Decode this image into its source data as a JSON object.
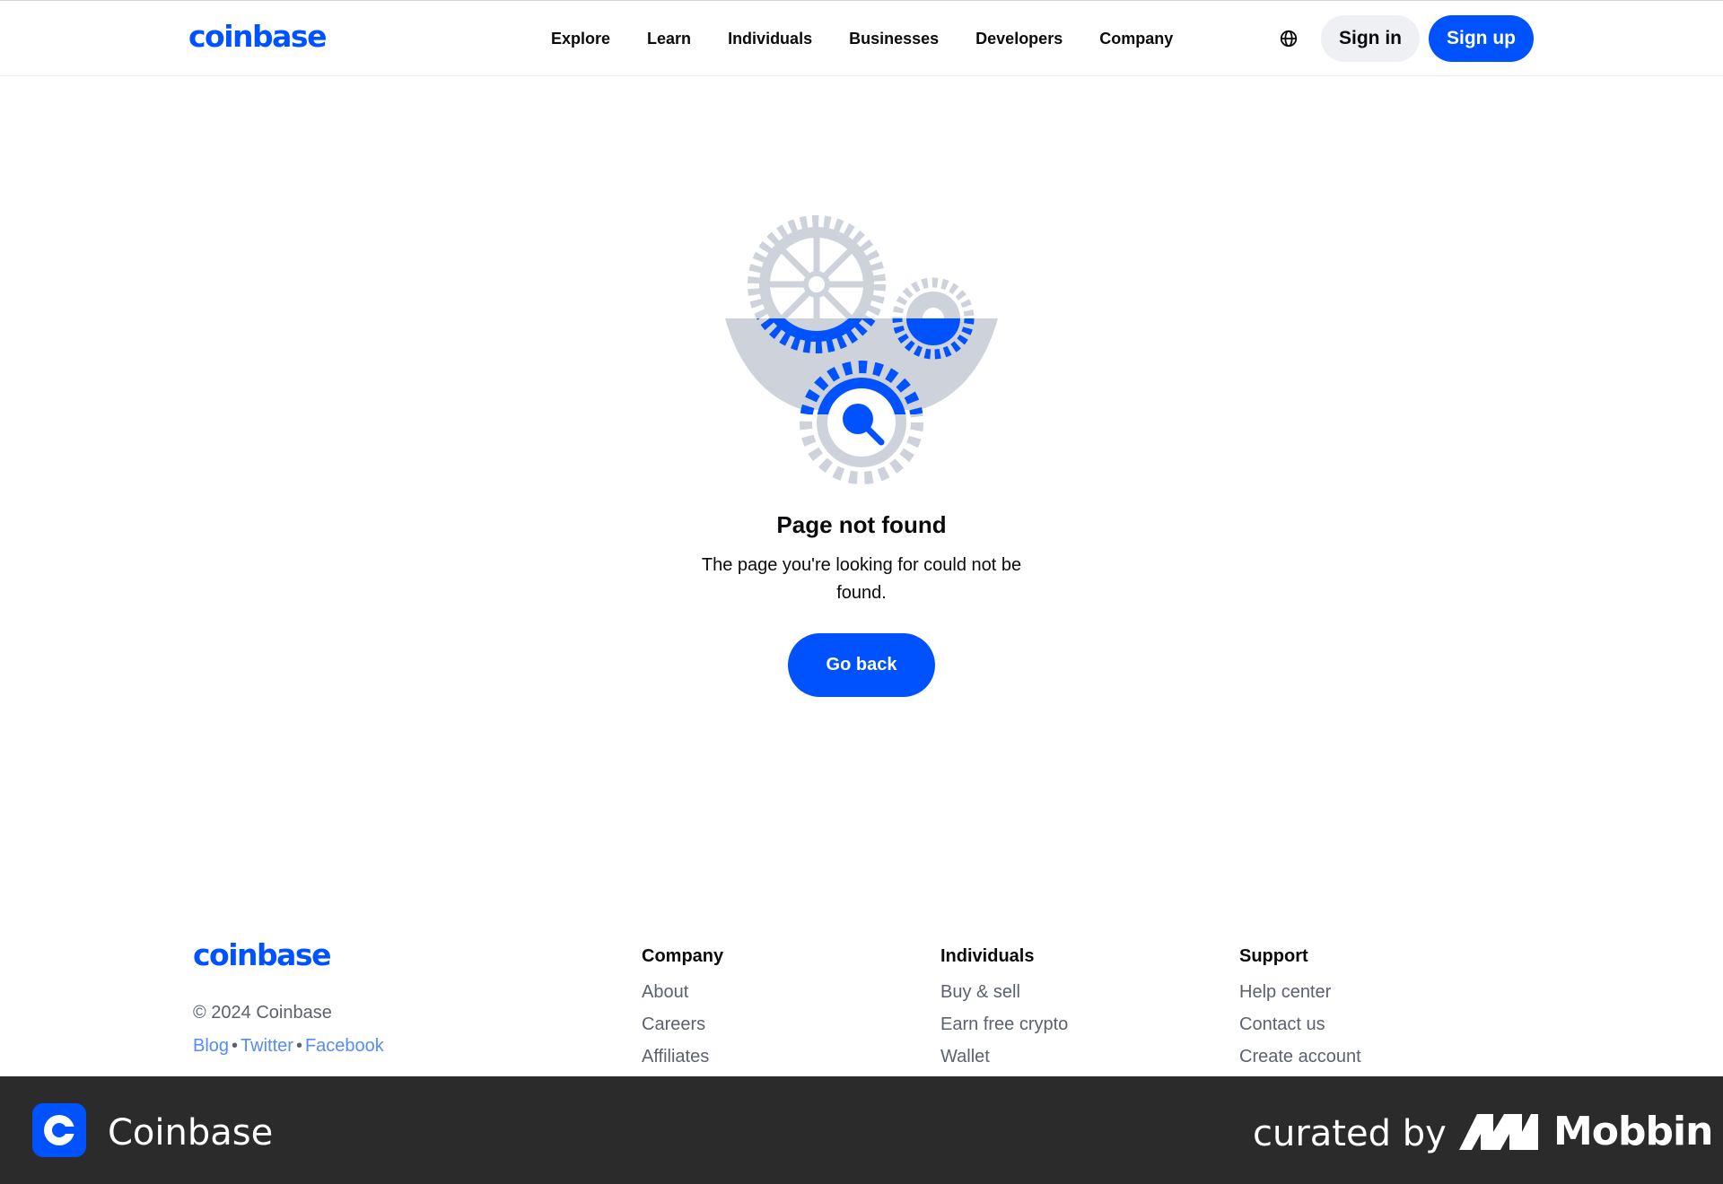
{
  "header": {
    "logo": "coinbase",
    "nav": [
      "Explore",
      "Learn",
      "Individuals",
      "Businesses",
      "Developers",
      "Company"
    ],
    "globe_icon": "globe-icon",
    "sign_in": "Sign in",
    "sign_up": "Sign up"
  },
  "main": {
    "illustration_icon": "gears-search-icon",
    "title": "Page not found",
    "description": "The page you're looking for could not be found.",
    "go_back": "Go back"
  },
  "footer": {
    "logo": "coinbase",
    "copyright": "© 2024 Coinbase",
    "social": [
      "Blog",
      "Twitter",
      "Facebook"
    ],
    "columns": [
      {
        "heading": "Company",
        "links": [
          "About",
          "Careers",
          "Affiliates"
        ]
      },
      {
        "heading": "Individuals",
        "links": [
          "Buy & sell",
          "Earn free crypto",
          "Wallet"
        ]
      },
      {
        "heading": "Support",
        "links": [
          "Help center",
          "Contact us",
          "Create account"
        ]
      }
    ]
  },
  "banner": {
    "app_name": "Coinbase",
    "curated_by": "curated by",
    "brand": "Mobbin"
  },
  "colors": {
    "brand_blue": "#0052ff",
    "gear_gray": "#cdd2db",
    "banner_bg": "#2b2b2b"
  }
}
